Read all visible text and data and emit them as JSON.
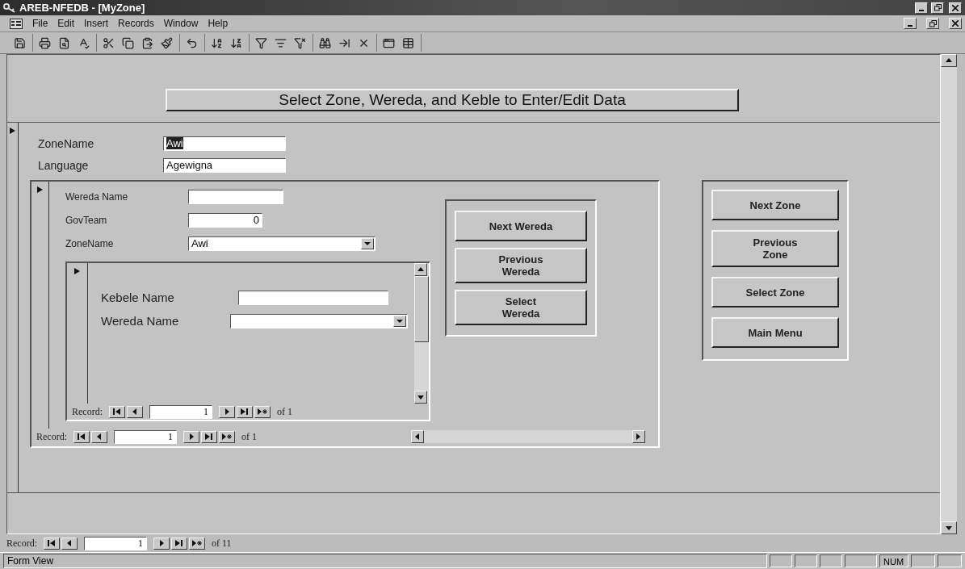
{
  "window": {
    "title": "AREB-NFEDB - [MyZone]"
  },
  "menu": [
    {
      "label": "File"
    },
    {
      "label": "Edit"
    },
    {
      "label": "Insert"
    },
    {
      "label": "Records"
    },
    {
      "label": "Window"
    },
    {
      "label": "Help"
    }
  ],
  "form": {
    "title_button": "Select Zone, Wereda, and Keble to Enter/Edit Data",
    "fields": [
      {
        "label": "ZoneName",
        "value": "Awi",
        "selected": true
      },
      {
        "label": "Language",
        "value": "Agewigna",
        "selected": false
      }
    ],
    "wereda_subform": {
      "fields": [
        {
          "label": "Wereda Name",
          "kind": "text"
        },
        {
          "label": "GovTeam",
          "kind": "number",
          "value": "0"
        },
        {
          "label": "ZoneName",
          "kind": "combo",
          "value": "Awi"
        }
      ],
      "kebele_subform": {
        "fields": [
          {
            "label": "Kebele Name",
            "kind": "text"
          },
          {
            "label": "Wereda Name",
            "kind": "combo"
          }
        ],
        "nav": {
          "label": "Record:",
          "current": "1",
          "total": "of 1"
        }
      },
      "buttons": [
        "Next Wereda",
        "Previous\nWereda",
        "Select\nWereda"
      ],
      "nav": {
        "label": "Record:",
        "current": "1",
        "total": "of 1"
      }
    },
    "zone_buttons": [
      "Next Zone",
      "Previous\nZone",
      "Select Zone",
      "Main Menu"
    ]
  },
  "nav": {
    "label": "Record:",
    "current": "1",
    "total": "of 11"
  },
  "status_bar": {
    "text": "Form View",
    "indicator": "NUM"
  }
}
